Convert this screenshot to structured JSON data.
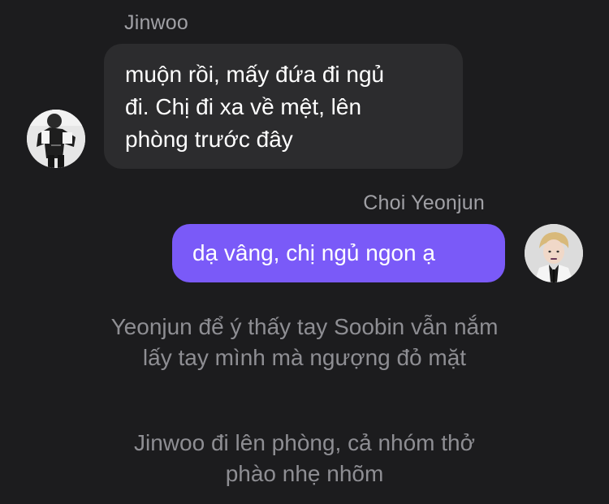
{
  "messages": [
    {
      "sender": "Jinwoo",
      "direction": "incoming",
      "avatar_icon": "person-avatar-icon",
      "lines": [
        "muộn rồi, mấy đứa đi ngủ",
        "đi. Chị đi xa về mệt, lên",
        "phòng trước đây"
      ]
    },
    {
      "sender": "Choi Yeonjun",
      "direction": "outgoing",
      "avatar_icon": "person-avatar-icon",
      "lines": [
        "dạ vâng, chị ngủ ngon ạ"
      ]
    }
  ],
  "narrations": [
    {
      "lines": [
        "Yeonjun để ý thấy tay Soobin vẫn nắm",
        "lấy tay mình mà ngượng đỏ mặt"
      ]
    },
    {
      "lines": [
        "Jinwoo đi lên phòng, cả nhóm thở",
        "phào nhẹ nhõm"
      ]
    }
  ],
  "colors": {
    "background": "#1c1c1e",
    "incoming_bubble": "#2c2c2e",
    "outgoing_bubble": "#7a5af8",
    "sender_name": "#a0a0a5",
    "narration_text": "#8e8e93"
  }
}
